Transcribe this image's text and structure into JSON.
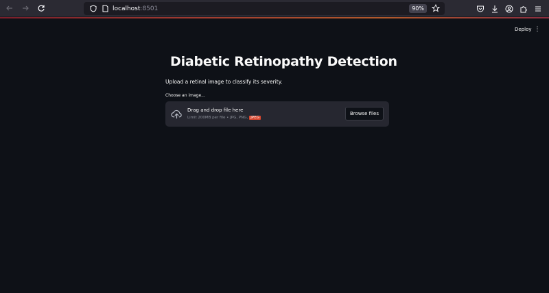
{
  "browser": {
    "url_host": "localhost",
    "url_port": ":8501",
    "zoom": "90%"
  },
  "header": {
    "deploy_label": "Deploy",
    "menu_glyph": "⋮"
  },
  "main": {
    "title": "Diabetic Retinopathy Detection",
    "title_icon": "eye-icon",
    "subtitle": "Upload a retinal image to classify its severity.",
    "uploader": {
      "label": "Choose an image...",
      "drop_text": "Drag and drop file here",
      "limits_text": "Limit 200MB per file • JPG, PNG,",
      "highlight_type": "JPEG",
      "browse_label": "Browse files"
    }
  },
  "colors": {
    "app_background": "#0e1117",
    "dropzone": "#262730",
    "text": "#fafafa",
    "muted_text": "#8b8f99",
    "highlight": "#d9472f"
  }
}
